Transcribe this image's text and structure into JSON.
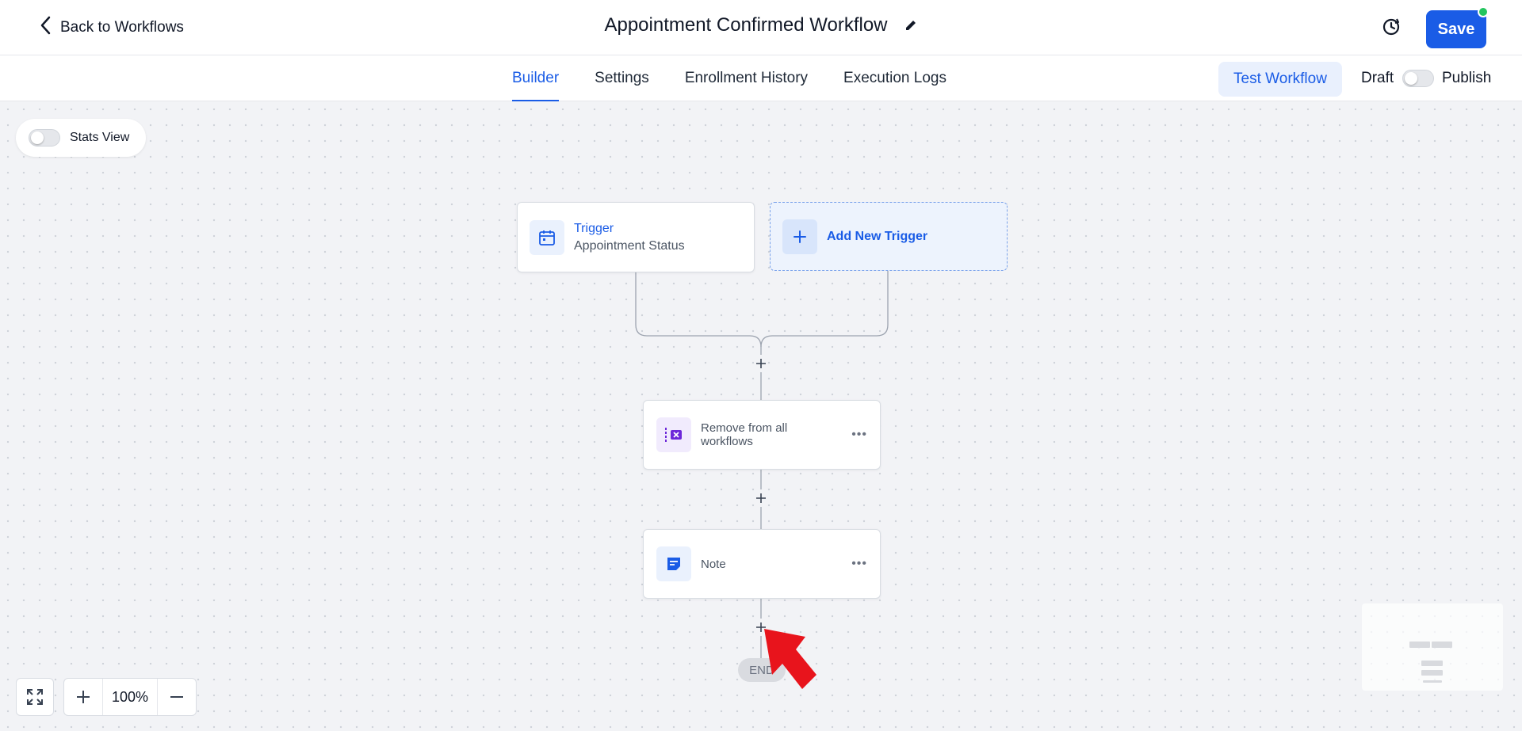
{
  "header": {
    "back_label": "Back to Workflows",
    "title": "Appointment Confirmed Workflow",
    "save_label": "Save"
  },
  "tabs": [
    {
      "label": "Builder",
      "active": true
    },
    {
      "label": "Settings",
      "active": false
    },
    {
      "label": "Enrollment History",
      "active": false
    },
    {
      "label": "Execution Logs",
      "active": false
    }
  ],
  "toolbar": {
    "test_label": "Test Workflow",
    "draft_label": "Draft",
    "publish_label": "Publish"
  },
  "canvas": {
    "stats_label": "Stats View",
    "trigger": {
      "title": "Trigger",
      "subtitle": "Appointment Status"
    },
    "add_trigger_label": "Add New Trigger",
    "actions": [
      {
        "label": "Remove from all workflows",
        "icon": "remove-workflow-icon"
      },
      {
        "label": "Note",
        "icon": "note-icon"
      }
    ],
    "end_label": "END",
    "zoom_level": "100%"
  },
  "colors": {
    "accent": "#1a5ce6",
    "purple": "#6d28d9",
    "status_dot": "#22c55e",
    "cursor_arrow": "#e8141c"
  }
}
